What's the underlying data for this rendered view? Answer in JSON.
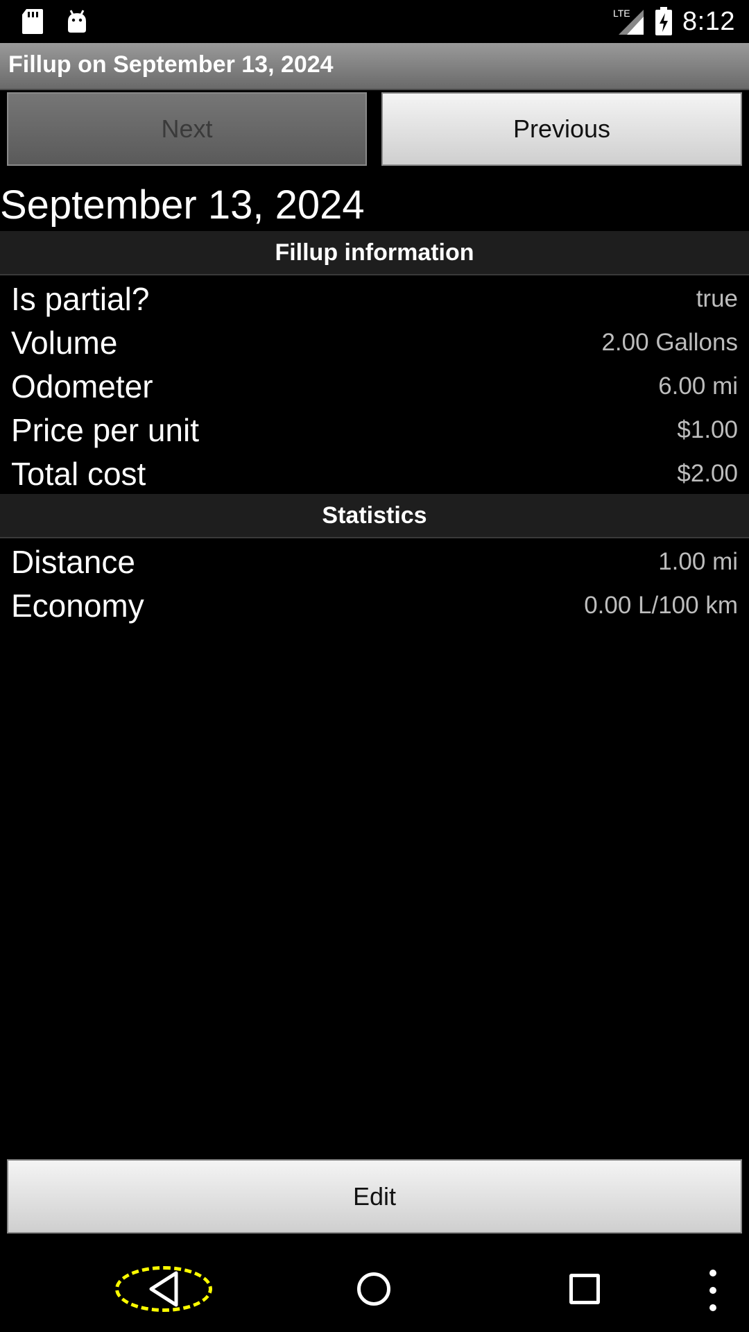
{
  "status_bar": {
    "time": "8:12",
    "network_label": "LTE",
    "icons": [
      "sd-card-icon",
      "android-icon",
      "signal-icon",
      "battery-charging-icon"
    ]
  },
  "title_bar": {
    "title": "Fillup on September 13, 2024"
  },
  "navigation": {
    "next_label": "Next",
    "previous_label": "Previous"
  },
  "date_heading": "September 13, 2024",
  "fillup_section": {
    "header": "Fillup information",
    "rows": [
      {
        "label": "Is partial?",
        "value": "true"
      },
      {
        "label": "Volume",
        "value": "2.00 Gallons"
      },
      {
        "label": "Odometer",
        "value": "6.00 mi"
      },
      {
        "label": "Price per unit",
        "value": "$1.00"
      },
      {
        "label": "Total cost",
        "value": "$2.00"
      }
    ]
  },
  "statistics_section": {
    "header": "Statistics",
    "rows": [
      {
        "label": "Distance",
        "value": "1.00 mi"
      },
      {
        "label": "Economy",
        "value": "0.00 L/100 km"
      }
    ]
  },
  "actions": {
    "edit_label": "Edit"
  },
  "nav_bar": {
    "icons": [
      "back-icon",
      "home-icon",
      "recents-icon",
      "overflow-menu-icon"
    ],
    "highlight_color": "#ffff00"
  }
}
